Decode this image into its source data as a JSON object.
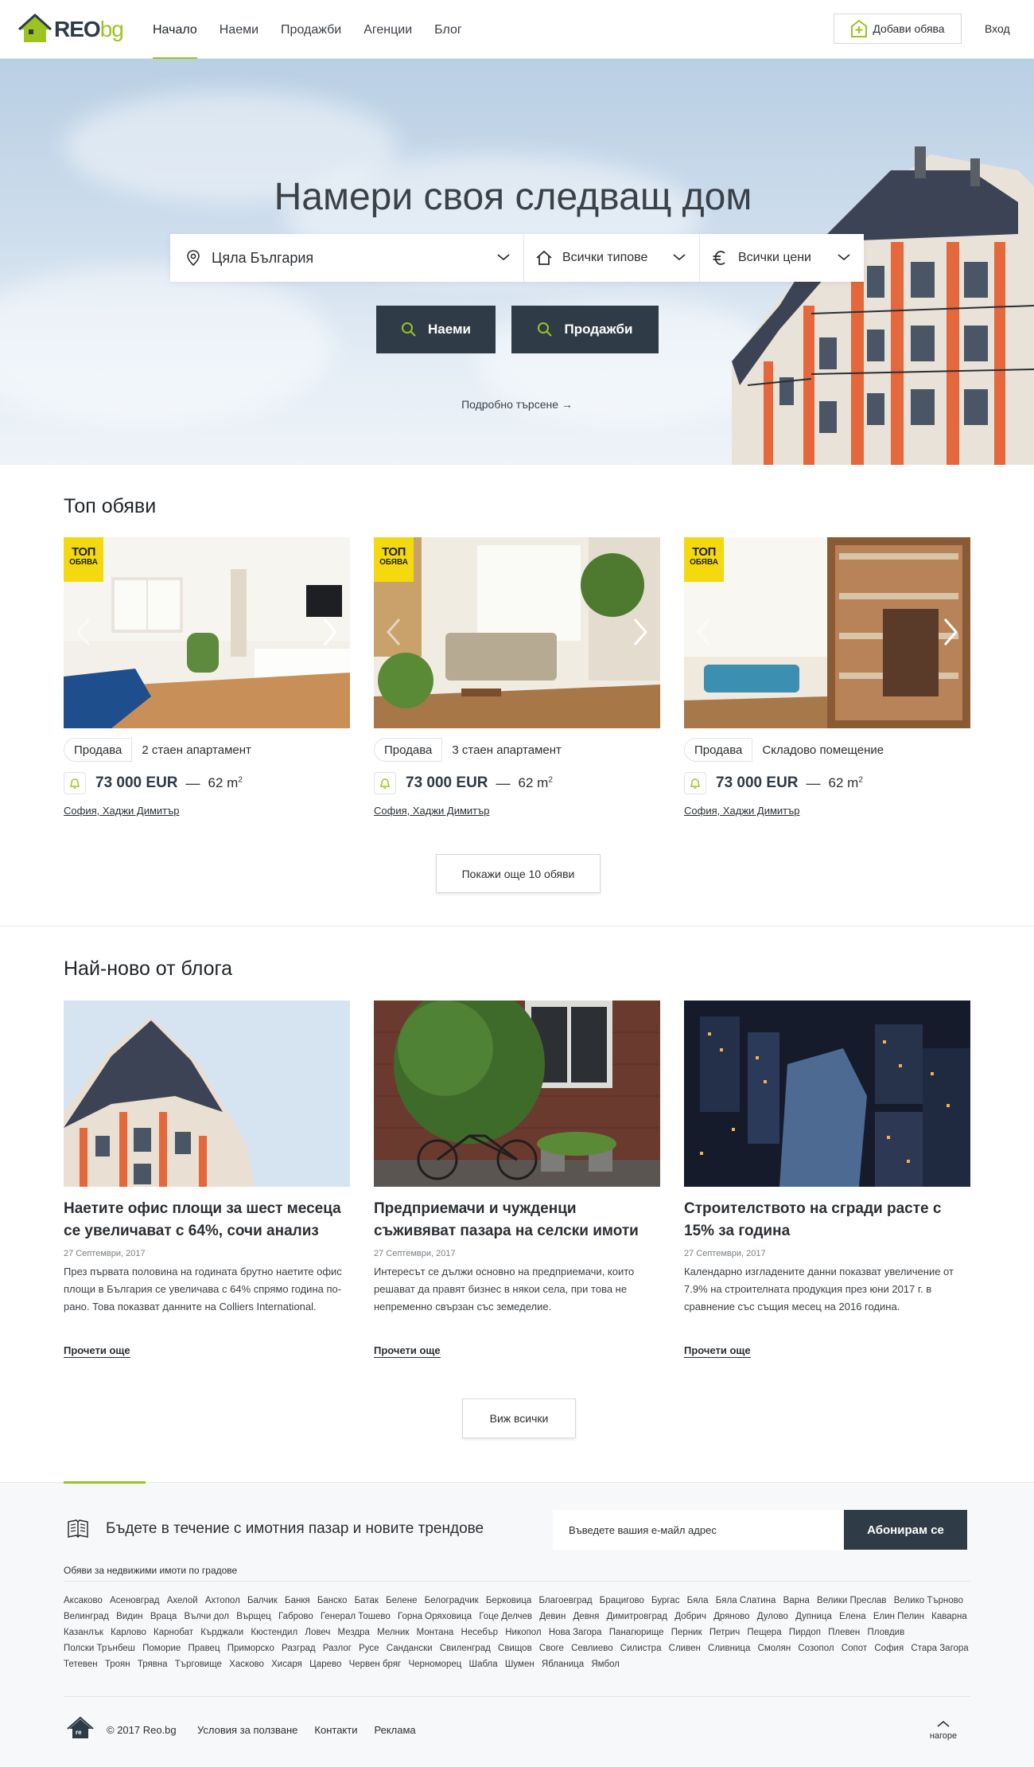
{
  "header": {
    "logo_main": "REO",
    "logo_suffix": "bg",
    "nav": [
      "Начало",
      "Наеми",
      "Продажби",
      "Агенции",
      "Блог"
    ],
    "add_listing": "Добави обява",
    "login": "Вход"
  },
  "hero": {
    "title": "Намери своя следващ дом",
    "location": "Цяла България",
    "types": "Всички типове",
    "prices": "Всички цени",
    "btn_rent": "Наеми",
    "btn_sale": "Продажби",
    "advanced": "Подробно търсене →"
  },
  "top": {
    "title": "Топ обяви",
    "badge_1": "ТОП",
    "badge_2": "ОБЯВА",
    "listings": [
      {
        "deal": "Продава",
        "type": "2 стаен апартамент",
        "price": "73 000 EUR",
        "area": "62 m",
        "location": "София, Хаджи Димитър"
      },
      {
        "deal": "Продава",
        "type": "3 стаен апартамент",
        "price": "73 000 EUR",
        "area": "62 m",
        "location": "София, Хаджи Димитър"
      },
      {
        "deal": "Продава",
        "type": "Складово помещение",
        "price": "73 000 EUR",
        "area": "62 m",
        "location": "София, Хаджи Димитър"
      }
    ],
    "area_sup": "2",
    "more": "Покажи още 10 обяви"
  },
  "blog": {
    "title": "Най-ново от блога",
    "posts": [
      {
        "title": "Наетите офис площи за шест месеца се увеличават с 64%, сочи анализ",
        "date": "27 Септември, 2017",
        "text": "През първата половина на годината брутно наетите офис площи в България се увеличава с 64% спрямо година по-рано. Това показват данните на Colliers International.",
        "more": "Прочети още"
      },
      {
        "title": "Предприемачи и чужденци съживяват пазара на селски имоти",
        "date": "27 Септември, 2017",
        "text": "Интересът се дължи основно на предприемачи, които решават да правят бизнес в някои села, при това не непременно свързан със земеделие.",
        "more": "Прочети още"
      },
      {
        "title": "Строителството на сгради расте с 15% за година",
        "date": "27 Септември, 2017",
        "text": "Календарно изгладените данни показват увеличение от 7.9% на строителната продукция през юни 2017 г. в сравнение със същия месец на 2016 година.",
        "more": "Прочети още"
      }
    ],
    "all": "Виж всички"
  },
  "footer": {
    "newsletter": "Бъдете в течение с имотния пазар и новите трендове",
    "email_placeholder": "Въведете вашия е-майл адрес",
    "subscribe": "Абонирам се",
    "cities_title": "Обяви за недвижими имоти по градове",
    "cities": [
      "Аксаково",
      "Асеновград",
      "Ахелой",
      "Ахтопол",
      "Балчик",
      "Банкя",
      "Банско",
      "Батак",
      "Белене",
      "Белоградчик",
      "Берковица",
      "Благоевград",
      "Брацигово",
      "Бургас",
      "Бяла",
      "Бяла Слатина",
      "Варна",
      "Велики Преслав",
      "Велико Търново",
      "Велинград",
      "Видин",
      "Враца",
      "Вълчи дол",
      "Върщец",
      "Габрово",
      "Генерал Тошево",
      "Горна Оряховица",
      "Гоце Делчев",
      "Девин",
      "Девня",
      "Димитровград",
      "Добрич",
      "Дряново",
      "Дулово",
      "Дупница",
      "Елена",
      "Елин Пелин",
      "Каварна",
      "Казанлък",
      "Карлово",
      "Карнобат",
      "Кърджали",
      "Кюстендил",
      "Ловеч",
      "Мездра",
      "Мелник",
      "Монтана",
      "Несебър",
      "Никопол",
      "Нова Загора",
      "Панагюрище",
      "Перник",
      "Петрич",
      "Пещера",
      "Пирдоп",
      "Плевен",
      "Пловдив",
      "Полски Трънбеш",
      "Поморие",
      "Правец",
      "Приморско",
      "Разград",
      "Разлог",
      "Русе",
      "Сандански",
      "Свиленград",
      "Свищов",
      "Своге",
      "Севлиево",
      "Силистра",
      "Сливен",
      "Сливница",
      "Смолян",
      "Созопол",
      "Сопот",
      "София",
      "Стара Загора",
      "Тетевен",
      "Троян",
      "Трявна",
      "Търговище",
      "Хасково",
      "Хисаря",
      "Царево",
      "Червен бряг",
      "Черноморец",
      "Шабла",
      "Шумен",
      "Ябланица",
      "Ямбол"
    ],
    "copyright": "© 2017 Reo.bg",
    "links": [
      "Условия за ползване",
      "Контакти",
      "Реклама"
    ],
    "to_top": "нагоре"
  },
  "colors": {
    "accent": "#9cc31f",
    "dark": "#2f3c47",
    "badge": "#f5d90f"
  }
}
